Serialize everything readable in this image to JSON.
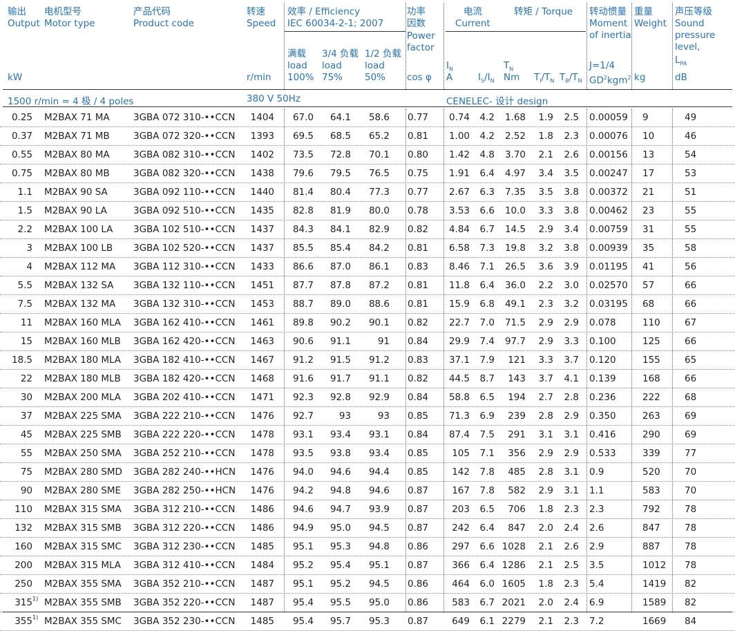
{
  "header": {
    "output_cn": "输出",
    "output_en": "Output",
    "output_unit": "kW",
    "motor_cn": "电机型号",
    "motor_en": "Motor type",
    "code_cn": "产品代码",
    "code_en": "Product code",
    "speed_cn": "转速",
    "speed_en": "Speed",
    "speed_unit": "r/min",
    "eff_title": "效率 / Efficiency",
    "eff_std": "IEC 60034-2-1; 2007",
    "eff_full_cn": "满载",
    "eff_full_l1": "load",
    "eff_full_l2": "100%",
    "eff_34_cn": "3/4 负载",
    "eff_34_l1": "load",
    "eff_34_l2": "75%",
    "eff_12_cn": "1/2 负载",
    "eff_12_l1": "load",
    "eff_12_l2": "50%",
    "pf_cn1": "功率",
    "pf_cn2": "因数",
    "pf_en1": "Power",
    "pf_en2": "factor",
    "pf_unit": "cos φ",
    "current_cn": "电流",
    "current_en": "Current",
    "torque_title": "转矩 / Torque",
    "in_sym": "I",
    "in_sub": "N",
    "in_unit": "A",
    "isin_a": "I",
    "isin_as": "S",
    "isin_b": "/I",
    "isin_bs": "N",
    "tn_sym": "T",
    "tn_sub": "N",
    "tn_unit": "Nm",
    "titn_a": "T",
    "titn_as": "I",
    "titn_b": "/T",
    "titn_bs": "N",
    "tbtn_a": "T",
    "tbtn_as": "B",
    "tbtn_b": "/T",
    "tbtn_bs": "N",
    "inertia_cn": "转动惯量",
    "inertia_en1": "Moment",
    "inertia_en2": "of inertia",
    "inertia_j": "J=1/4",
    "inertia_unit_a": "GD",
    "inertia_unit_sup": "2",
    "inertia_unit_b": "kgm",
    "inertia_unit_sup2": "2",
    "weight_cn": "重量",
    "weight_en": "Weight",
    "weight_unit": "kg",
    "sound_cn": "声压等级",
    "sound_en1": "Sound",
    "sound_en2": "pressure",
    "sound_en3": "level,",
    "sound_sym": "L",
    "sound_sub": "PA",
    "sound_unit": "dB"
  },
  "subheader": {
    "poles": "1500 r/min = 4 极 / 4 poles",
    "voltage": "380 V 50Hz",
    "design": "CENELEC- 设计 design"
  },
  "rows": [
    {
      "kw": "0.25",
      "fn": "",
      "type": "M2BAX 71 MA",
      "code": "3GBA 072 310-••CCN",
      "rpm": "1404",
      "e100": "67.0",
      "e75": "64.1",
      "e50": "58.6",
      "pf": "0.77",
      "in": "0.74",
      "isin": "4.2",
      "tn": "1.68",
      "titn": "1.9",
      "tbtn": "2.5",
      "j": "0.00059",
      "kg": "9",
      "db": "49"
    },
    {
      "kw": "0.37",
      "fn": "",
      "type": "M2BAX 71 MB",
      "code": "3GBA 072 320-••CCN",
      "rpm": "1393",
      "e100": "69.5",
      "e75": "68.5",
      "e50": "65.2",
      "pf": "0.81",
      "in": "1.00",
      "isin": "4.2",
      "tn": "2.52",
      "titn": "1.8",
      "tbtn": "2.3",
      "j": "0.00076",
      "kg": "10",
      "db": "46"
    },
    {
      "kw": "0.55",
      "fn": "",
      "type": "M2BAX 80 MA",
      "code": "3GBA 082 310-••CCN",
      "rpm": "1402",
      "e100": "73.5",
      "e75": "72.8",
      "e50": "70.1",
      "pf": "0.80",
      "in": "1.42",
      "isin": "4.8",
      "tn": "3.70",
      "titn": "2.1",
      "tbtn": "2.6",
      "j": "0.00156",
      "kg": "13",
      "db": "54"
    },
    {
      "kw": "0.75",
      "fn": "",
      "type": "M2BAX 80 MB",
      "code": "3GBA 082 320-••CCN",
      "rpm": "1438",
      "e100": "79.6",
      "e75": "79.5",
      "e50": "76.5",
      "pf": "0.75",
      "in": "1.91",
      "isin": "6.4",
      "tn": "4.97",
      "titn": "3.4",
      "tbtn": "3.5",
      "j": "0.00247",
      "kg": "17",
      "db": "53"
    },
    {
      "kw": "1.1",
      "fn": "",
      "type": "M2BAX 90 SA",
      "code": "3GBA 092 110-••CCN",
      "rpm": "1440",
      "e100": "81.4",
      "e75": "80.4",
      "e50": "77.3",
      "pf": "0.77",
      "in": "2.67",
      "isin": "6.3",
      "tn": "7.35",
      "titn": "3.5",
      "tbtn": "3.8",
      "j": "0.00372",
      "kg": "21",
      "db": "51"
    },
    {
      "kw": "1.5",
      "fn": "",
      "type": "M2BAX 90 LA",
      "code": "3GBA 092 510-••CCN",
      "rpm": "1435",
      "e100": "82.8",
      "e75": "81.9",
      "e50": "80.0",
      "pf": "0.78",
      "in": "3.53",
      "isin": "6.6",
      "tn": "10.0",
      "titn": "3.3",
      "tbtn": "3.8",
      "j": "0.00462",
      "kg": "23",
      "db": "55"
    },
    {
      "kw": "2.2",
      "fn": "",
      "type": "M2BAX 100 LA",
      "code": "3GBA 102 510-••CCN",
      "rpm": "1437",
      "e100": "84.3",
      "e75": "84.1",
      "e50": "82.9",
      "pf": "0.82",
      "in": "4.84",
      "isin": "6.7",
      "tn": "14.5",
      "titn": "2.9",
      "tbtn": "3.4",
      "j": "0.00759",
      "kg": "31",
      "db": "55"
    },
    {
      "kw": "3",
      "fn": "",
      "type": "M2BAX 100 LB",
      "code": "3GBA 102 520-••CCN",
      "rpm": "1437",
      "e100": "85.5",
      "e75": "85.4",
      "e50": "84.2",
      "pf": "0.81",
      "in": "6.58",
      "isin": "7.3",
      "tn": "19.8",
      "titn": "3.2",
      "tbtn": "3.8",
      "j": "0.00939",
      "kg": "35",
      "db": "58"
    },
    {
      "kw": "4",
      "fn": "",
      "type": "M2BAX 112 MA",
      "code": "3GBA 112 310-••CCN",
      "rpm": "1433",
      "e100": "86.6",
      "e75": "87.0",
      "e50": "86.1",
      "pf": "0.83",
      "in": "8.46",
      "isin": "7.1",
      "tn": "26.5",
      "titn": "3.6",
      "tbtn": "3.9",
      "j": "0.01195",
      "kg": "41",
      "db": "56"
    },
    {
      "kw": "5.5",
      "fn": "",
      "type": "M2BAX 132 SA",
      "code": "3GBA 132 110-••CCN",
      "rpm": "1451",
      "e100": "87.7",
      "e75": "87.8",
      "e50": "87.2",
      "pf": "0.81",
      "in": "11.8",
      "isin": "6.4",
      "tn": "36.0",
      "titn": "2.2",
      "tbtn": "3.0",
      "j": "0.02570",
      "kg": "57",
      "db": "66"
    },
    {
      "kw": "7.5",
      "fn": "",
      "type": "M2BAX 132 MA",
      "code": "3GBA 132 310-••CCN",
      "rpm": "1453",
      "e100": "88.7",
      "e75": "89.0",
      "e50": "88.6",
      "pf": "0.81",
      "in": "15.9",
      "isin": "6.8",
      "tn": "49.1",
      "titn": "2.3",
      "tbtn": "3.2",
      "j": "0.03195",
      "kg": "68",
      "db": "66"
    },
    {
      "kw": "11",
      "fn": "",
      "type": "M2BAX 160 MLA",
      "code": "3GBA 162 410-••CCN",
      "rpm": "1461",
      "e100": "89.8",
      "e75": "90.2",
      "e50": "90.1",
      "pf": "0.82",
      "in": "22.7",
      "isin": "7.0",
      "tn": "71.5",
      "titn": "2.9",
      "tbtn": "2.9",
      "j": "0.078",
      "kg": "110",
      "db": "67"
    },
    {
      "kw": "15",
      "fn": "",
      "type": "M2BAX 160 MLB",
      "code": "3GBA 162 420-••CCN",
      "rpm": "1463",
      "e100": "90.6",
      "e75": "91.1",
      "e50": "91",
      "pf": "0.84",
      "in": "29.9",
      "isin": "7.4",
      "tn": "97.7",
      "titn": "2.9",
      "tbtn": "3.3",
      "j": "0.100",
      "kg": "125",
      "db": "66"
    },
    {
      "kw": "18.5",
      "fn": "",
      "type": "M2BAX 180 MLA",
      "code": "3GBA 182 410-••CCN",
      "rpm": "1467",
      "e100": "91.2",
      "e75": "91.5",
      "e50": "91.2",
      "pf": "0.83",
      "in": "37.1",
      "isin": "7.9",
      "tn": "121",
      "titn": "3.3",
      "tbtn": "3.7",
      "j": "0.120",
      "kg": "155",
      "db": "65"
    },
    {
      "kw": "22",
      "fn": "",
      "type": "M2BAX 180 MLB",
      "code": "3GBA 182 420-••CCN",
      "rpm": "1468",
      "e100": "91.6",
      "e75": "91.7",
      "e50": "91.1",
      "pf": "0.82",
      "in": "44.5",
      "isin": "8.7",
      "tn": "143",
      "titn": "3.7",
      "tbtn": "4.1",
      "j": "0.139",
      "kg": "168",
      "db": "66"
    },
    {
      "kw": "30",
      "fn": "",
      "type": "M2BAX 200 MLA",
      "code": "3GBA 202 410-••CCN",
      "rpm": "1471",
      "e100": "92.3",
      "e75": "92.8",
      "e50": "92.9",
      "pf": "0.84",
      "in": "58.8",
      "isin": "6.5",
      "tn": "194",
      "titn": "2.7",
      "tbtn": "2.8",
      "j": "0.236",
      "kg": "222",
      "db": "68"
    },
    {
      "kw": "37",
      "fn": "",
      "type": "M2BAX 225 SMA",
      "code": "3GBA 222 210-••CCN",
      "rpm": "1476",
      "e100": "92.7",
      "e75": "93",
      "e50": "93",
      "pf": "0.85",
      "in": "71.3",
      "isin": "6.9",
      "tn": "239",
      "titn": "2.8",
      "tbtn": "2.9",
      "j": "0.350",
      "kg": "263",
      "db": "69"
    },
    {
      "kw": "45",
      "fn": "",
      "type": "M2BAX 225 SMB",
      "code": "3GBA 222 220-••CCN",
      "rpm": "1478",
      "e100": "93.1",
      "e75": "93.4",
      "e50": "93.1",
      "pf": "0.84",
      "in": "87.4",
      "isin": "7.5",
      "tn": "291",
      "titn": "3.1",
      "tbtn": "3.1",
      "j": "0.416",
      "kg": "290",
      "db": "69"
    },
    {
      "kw": "55",
      "fn": "",
      "type": "M2BAX 250 SMA",
      "code": "3GBA 252 210-••CCN",
      "rpm": "1478",
      "e100": "93.5",
      "e75": "93.8",
      "e50": "93.4",
      "pf": "0.85",
      "in": "105",
      "isin": "7.1",
      "tn": "356",
      "titn": "2.9",
      "tbtn": "2.9",
      "j": "0.533",
      "kg": "339",
      "db": "77"
    },
    {
      "kw": "75",
      "fn": "",
      "type": "M2BAX 280 SMD",
      "code": "3GBA 282 240-••HCN",
      "rpm": "1476",
      "e100": "94.0",
      "e75": "94.6",
      "e50": "94.4",
      "pf": "0.85",
      "in": "142",
      "isin": "7.8",
      "tn": "485",
      "titn": "2.8",
      "tbtn": "3.1",
      "j": "0.9",
      "kg": "520",
      "db": "70"
    },
    {
      "kw": "90",
      "fn": "",
      "type": "M2BAX 280 SME",
      "code": "3GBA 282 250-••HCN",
      "rpm": "1476",
      "e100": "94.2",
      "e75": "94.8",
      "e50": "94.6",
      "pf": "0.87",
      "in": "167",
      "isin": "7.8",
      "tn": "582",
      "titn": "2.9",
      "tbtn": "3.1",
      "j": "1.1",
      "kg": "583",
      "db": "70"
    },
    {
      "kw": "110",
      "fn": "",
      "type": "M2BAX 315 SMA",
      "code": "3GBA 312 210-••CCN",
      "rpm": "1486",
      "e100": "94.6",
      "e75": "94.7",
      "e50": "93.9",
      "pf": "0.87",
      "in": "203",
      "isin": "6.5",
      "tn": "706",
      "titn": "1.8",
      "tbtn": "2.3",
      "j": "2.3",
      "kg": "792",
      "db": "78"
    },
    {
      "kw": "132",
      "fn": "",
      "type": "M2BAX 315 SMB",
      "code": "3GBA 312 220-••CCN",
      "rpm": "1486",
      "e100": "94.9",
      "e75": "95.0",
      "e50": "94.5",
      "pf": "0.87",
      "in": "242",
      "isin": "6.4",
      "tn": "847",
      "titn": "2.0",
      "tbtn": "2.4",
      "j": "2.6",
      "kg": "847",
      "db": "78"
    },
    {
      "kw": "160",
      "fn": "",
      "type": "M2BAX 315 SMC",
      "code": "3GBA 312 230-••CCN",
      "rpm": "1485",
      "e100": "95.1",
      "e75": "95.3",
      "e50": "94.8",
      "pf": "0.86",
      "in": "297",
      "isin": "6.6",
      "tn": "1028",
      "titn": "2.1",
      "tbtn": "2.6",
      "j": "2.9",
      "kg": "887",
      "db": "78"
    },
    {
      "kw": "200",
      "fn": "",
      "type": "M2BAX 315 MLA",
      "code": "3GBA 312 410-••CCN",
      "rpm": "1484",
      "e100": "95.2",
      "e75": "95.4",
      "e50": "95.1",
      "pf": "0.87",
      "in": "366",
      "isin": "6.4",
      "tn": "1286",
      "titn": "2.1",
      "tbtn": "2.5",
      "j": "3.5",
      "kg": "1012",
      "db": "78"
    },
    {
      "kw": "250",
      "fn": "",
      "type": "M2BAX 355 SMA",
      "code": "3GBA 352 210-••CCN",
      "rpm": "1487",
      "e100": "95.1",
      "e75": "95.2",
      "e50": "94.5",
      "pf": "0.86",
      "in": "464",
      "isin": "6.0",
      "tn": "1605",
      "titn": "1.8",
      "tbtn": "2.3",
      "j": "5.4",
      "kg": "1419",
      "db": "82"
    },
    {
      "kw": "315",
      "fn": "1)",
      "type": "M2BAX 355 SMB",
      "code": "3GBA 352 220-••CCN",
      "rpm": "1487",
      "e100": "95.4",
      "e75": "95.5",
      "e50": "95.0",
      "pf": "0.86",
      "in": "583",
      "isin": "6.7",
      "tn": "2021",
      "titn": "2.0",
      "tbtn": "2.4",
      "j": "6.9",
      "kg": "1589",
      "db": "82"
    },
    {
      "kw": "355",
      "fn": "1)",
      "type": "M2BAX 355 SMC",
      "code": "3GBA 352 230-••CCN",
      "rpm": "1485",
      "e100": "95.4",
      "e75": "95.7",
      "e50": "95.3",
      "pf": "0.87",
      "in": "649",
      "isin": "6.1",
      "tn": "2279",
      "titn": "2.1",
      "tbtn": "2.3",
      "j": "7.2",
      "kg": "1669",
      "db": "84"
    }
  ]
}
